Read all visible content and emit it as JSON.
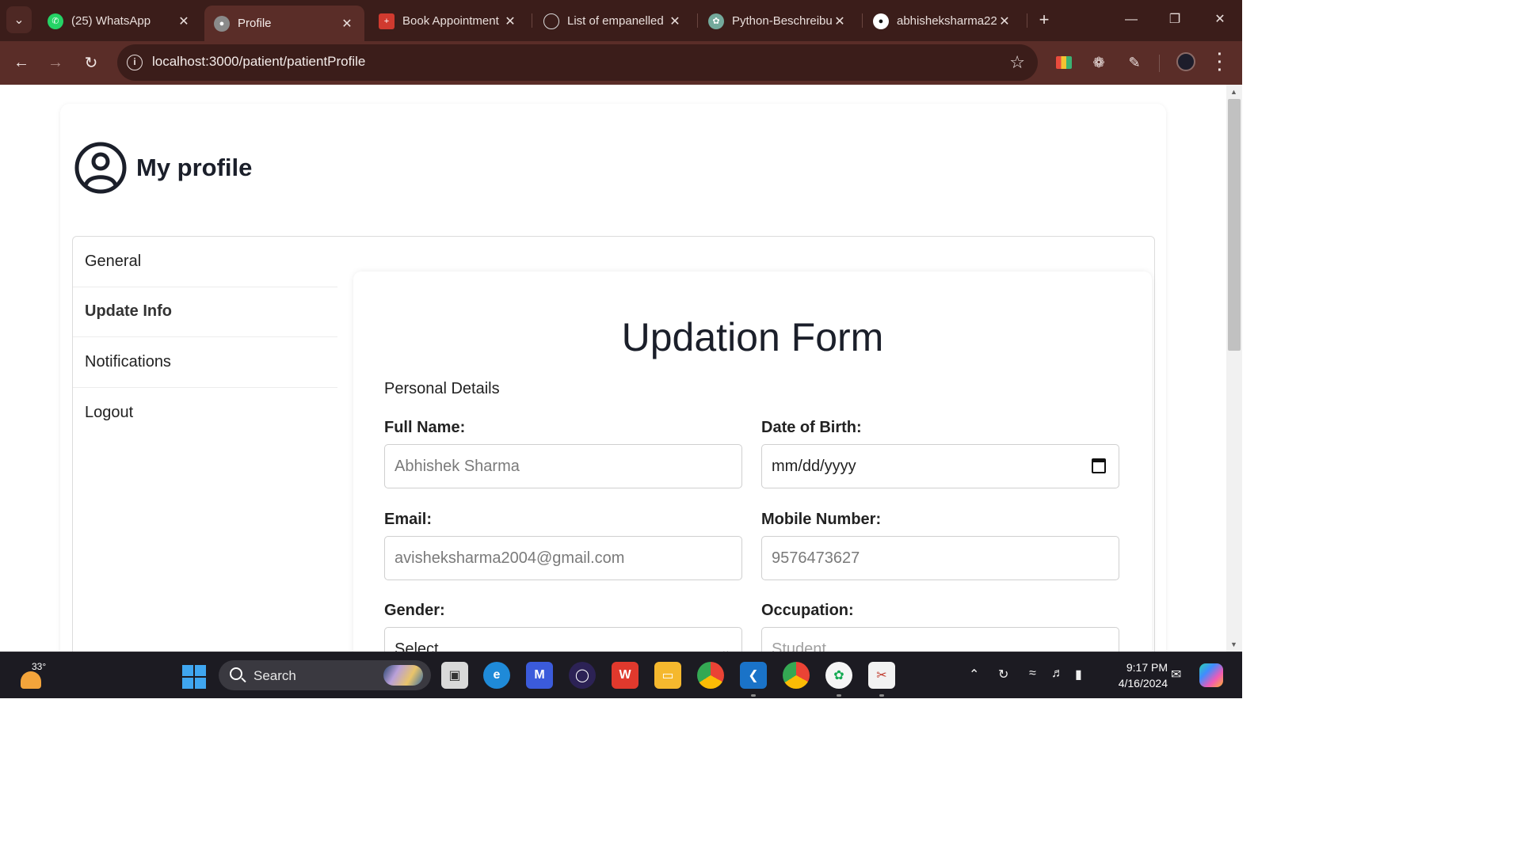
{
  "browser": {
    "tabs": [
      {
        "title": "(25) WhatsApp",
        "icon": "whatsapp-icon",
        "color": "#25d366",
        "active": false
      },
      {
        "title": "Profile",
        "icon": "globe-icon",
        "color": "#8a8a8a",
        "active": true
      },
      {
        "title": "Book Appointment",
        "icon": "pharmacy-icon",
        "color": "#d03a2f",
        "active": false
      },
      {
        "title": "List of empanelled",
        "icon": "emblem-icon",
        "color": "#d9d9d9",
        "active": false
      },
      {
        "title": "Python-Beschreibu",
        "icon": "chatgpt-icon",
        "color": "#74aa9c",
        "active": false
      },
      {
        "title": "abhisheksharma22",
        "icon": "github-icon",
        "color": "#ffffff",
        "active": false
      }
    ],
    "url": "localhost:3000/patient/patientProfile"
  },
  "page": {
    "profile_title": "My profile",
    "sidenav": [
      {
        "label": "General",
        "active": false
      },
      {
        "label": "Update Info",
        "active": true
      },
      {
        "label": "Notifications",
        "active": false
      },
      {
        "label": "Logout",
        "active": false
      }
    ],
    "form": {
      "title": "Updation Form",
      "section": "Personal Details",
      "fields": {
        "full_name": {
          "label": "Full Name:",
          "value": "Abhishek Sharma"
        },
        "dob": {
          "label": "Date of Birth:",
          "value": "mm/dd/yyyy"
        },
        "email": {
          "label": "Email:",
          "value": "avisheksharma2004@gmail.com"
        },
        "mobile": {
          "label": "Mobile Number:",
          "value": "9576473627"
        },
        "gender": {
          "label": "Gender:",
          "value": "Select"
        },
        "occupation": {
          "label": "Occupation:",
          "value": "Student"
        }
      }
    }
  },
  "taskbar": {
    "weather_temp": "33°",
    "search_label": "Search",
    "time": "9:17 PM",
    "date": "4/16/2024"
  }
}
